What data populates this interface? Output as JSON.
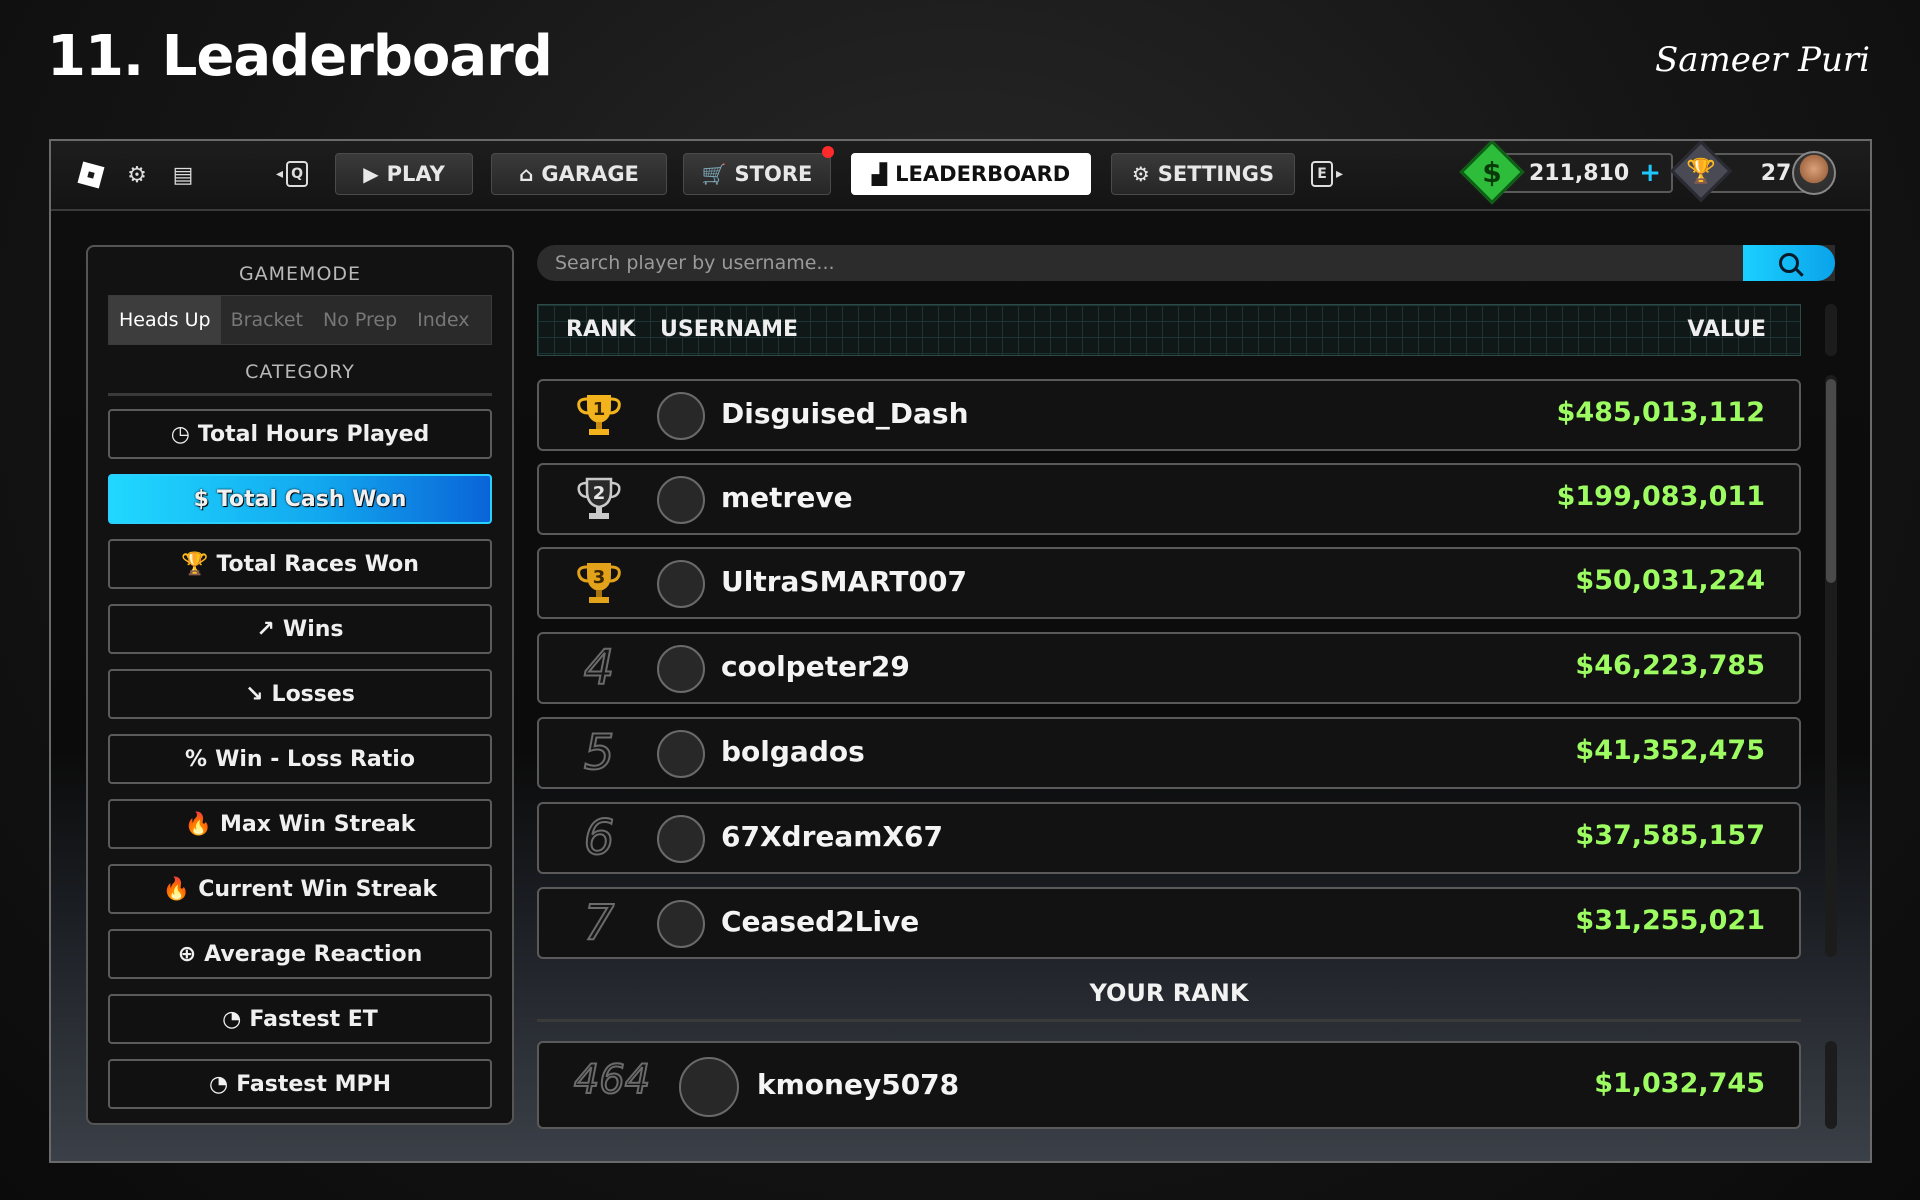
{
  "slide": {
    "title": "11. Leaderboard",
    "author": "Sameer Puri"
  },
  "topbar": {
    "key_left": "Q",
    "key_right": "E",
    "nav": [
      {
        "label": "PLAY",
        "icon": "play-icon"
      },
      {
        "label": "GARAGE",
        "icon": "garage-icon"
      },
      {
        "label": "STORE",
        "icon": "cart-icon"
      },
      {
        "label": "LEADERBOARD",
        "icon": "bar-chart-icon"
      },
      {
        "label": "SETTINGS",
        "icon": "gear-icon"
      }
    ],
    "active_tab": "LEADERBOARD",
    "cash": "211,810",
    "trophies": "27"
  },
  "sidebar": {
    "gamemode_heading": "GAMEMODE",
    "gamemodes": [
      "Heads Up",
      "Bracket",
      "No Prep",
      "Index"
    ],
    "active_gamemode": "Heads Up",
    "category_heading": "CATEGORY",
    "categories": [
      {
        "label": "Total Hours Played",
        "icon": "clock-icon",
        "glyph": "◷"
      },
      {
        "label": "Total Cash Won",
        "icon": "dollar-icon",
        "glyph": "$"
      },
      {
        "label": "Total Races Won",
        "icon": "trophy-icon",
        "glyph": "🏆"
      },
      {
        "label": "Wins",
        "icon": "trend-up-icon",
        "glyph": "↗"
      },
      {
        "label": "Losses",
        "icon": "trend-down-icon",
        "glyph": "↘"
      },
      {
        "label": "Win - Loss Ratio",
        "icon": "percent-icon",
        "glyph": "%"
      },
      {
        "label": "Max Win Streak",
        "icon": "flame-icon",
        "glyph": "🔥"
      },
      {
        "label": "Current Win Streak",
        "icon": "flame-icon",
        "glyph": "🔥"
      },
      {
        "label": "Average Reaction",
        "icon": "crosshair-icon",
        "glyph": "⊕"
      },
      {
        "label": "Fastest ET",
        "icon": "speedometer-icon",
        "glyph": "◔"
      },
      {
        "label": "Fastest MPH",
        "icon": "speedometer-icon",
        "glyph": "◔"
      }
    ],
    "active_category": "Total Cash Won"
  },
  "search": {
    "placeholder": "Search player by username..."
  },
  "table": {
    "headers": {
      "rank": "RANK",
      "username": "USERNAME",
      "value": "VALUE"
    },
    "rows": [
      {
        "rank": "1",
        "username": "Disguised_Dash",
        "value": "$485,013,112"
      },
      {
        "rank": "2",
        "username": "metreve",
        "value": "$199,083,011"
      },
      {
        "rank": "3",
        "username": "UltraSMART007",
        "value": "$50,031,224"
      },
      {
        "rank": "4",
        "username": "coolpeter29",
        "value": "$46,223,785"
      },
      {
        "rank": "5",
        "username": "bolgados",
        "value": "$41,352,475"
      },
      {
        "rank": "6",
        "username": "67XdreamX67",
        "value": "$37,585,157"
      },
      {
        "rank": "7",
        "username": "Ceased2Live",
        "value": "$31,255,021"
      }
    ]
  },
  "your_rank": {
    "title": "YOUR RANK",
    "rank": "464",
    "username": "kmoney5078",
    "value": "$1,032,745"
  },
  "colors": {
    "value_green": "#9dfc61",
    "accent_cyan": "#1bd0ff",
    "gold": "#f2b31c",
    "silver": "#c9c9c9",
    "bronze": "#e2a21a"
  }
}
